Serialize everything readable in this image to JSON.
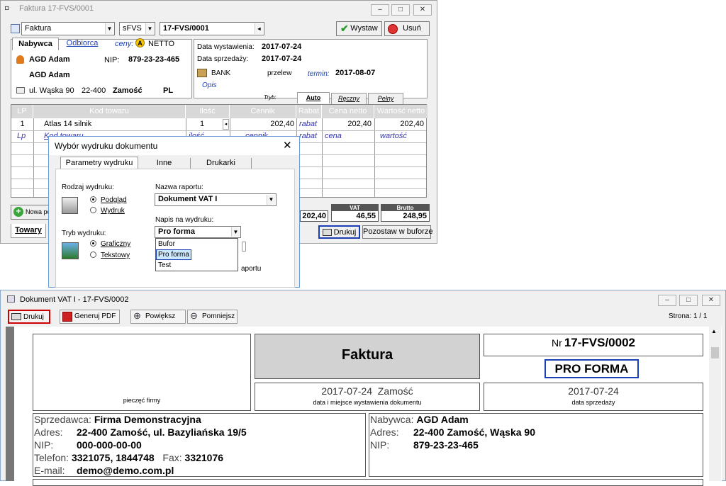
{
  "invoice_window": {
    "title": "Faktura 17-FVS/0001",
    "doc_type": "Faktura",
    "series": "sFVS",
    "number": "17-FVS/0001",
    "issue_button": "Wystaw",
    "delete_button": "Usuń",
    "tabs": [
      "Nabywca",
      "Odbiorca"
    ],
    "prices_label": "ceny:",
    "prices_mode_icon": "A",
    "prices_mode": "NETTO",
    "buyer": {
      "name": "AGD Adam",
      "nip_label": "NIP:",
      "nip": "879-23-23-465",
      "name2": "AGD Adam",
      "street": "ul. Wąska 90",
      "postal": "22-400",
      "city": "Zamość",
      "country": "PL"
    },
    "date_issue_label": "Data wystawienia:",
    "date_issue": "2017-07-24",
    "date_sale_label": "Data sprzedaży:",
    "date_sale": "2017-07-24",
    "payment_method": "BANK",
    "payment_type": "przelew",
    "due_label": "termin:",
    "due_date": "2017-08-07",
    "notes_label": "Opis",
    "mode_label": "Tryb:",
    "mode_tabs": [
      "Auto",
      "Ręczny",
      "Pełny"
    ],
    "grid_headers": [
      "LP",
      "Kod towaru",
      "Ilość",
      "Cennik",
      "Rabat",
      "Cena netto",
      "Wartość netto"
    ],
    "grid_rows": [
      [
        "1",
        "Atlas 14 silnik",
        "1",
        "202,40",
        "rabat",
        "202,40",
        "202,40"
      ]
    ],
    "grid_new_row": [
      "Lp",
      "Kod towaru",
      "ilość",
      "cennik",
      "rabat",
      "cena",
      "wartość"
    ],
    "new_button": "Nowa po",
    "net_total": "202,40",
    "vat_label": "VAT",
    "vat_total": "46,55",
    "gross_label": "Brutto",
    "gross_total": "248,95",
    "goods_tab": "Towary",
    "print_button": "Drukuj",
    "leave_buffer_button": "Pozostaw w buforze"
  },
  "print_dialog": {
    "title": "Wybór wydruku dokumentu",
    "tabs": [
      "Parametry wydruku",
      "Inne",
      "Drukarki"
    ],
    "output_label": "Rodzaj wydruku:",
    "output_options": [
      "Podgląd",
      "Wydruk"
    ],
    "report_label": "Nazwa raportu:",
    "report_value": "Dokument VAT I",
    "caption_label": "Napis na wydruku:",
    "caption_value": "Pro forma",
    "caption_options": [
      "Bufor",
      "Pro forma",
      "Test"
    ],
    "mode_label": "Tryb wydruku:",
    "mode_options": [
      "Graficzny",
      "Tekstowy"
    ],
    "partial_text": "aportu"
  },
  "preview_window": {
    "title": "Dokument VAT I - 17-FVS/0002",
    "toolbar": [
      "Drukuj",
      "Generuj PDF",
      "Powiększ",
      "Pomniejsz"
    ],
    "page_info": "Strona: 1 / 1",
    "doc": {
      "stamp_label": "pieczęć firmy",
      "doc_title": "Faktura",
      "nr_label": "Nr",
      "nr_value": "17-FVS/0002",
      "pro_forma": "PRO FORMA",
      "issue_place": "2017-07-24  Zamość",
      "issue_caption": "data i miejsce wystawienia dokumentu",
      "sale_date": "2017-07-24",
      "sale_caption": "data sprzedaży",
      "seller_label": "Sprzedawca:",
      "seller_name": "Firma Demonstracyjna",
      "seller_addr_label": "Adres:",
      "seller_addr": "22-400 Zamość, ul. Bazyliańska 19/5",
      "seller_nip_label": "NIP:",
      "seller_nip": "000-000-00-00",
      "phone_label": "Telefon:",
      "phone": "3321075, 1844748",
      "fax_label": "Fax:",
      "fax": "3321076",
      "email_label": "E-mail:",
      "email": "demo@demo.com.pl",
      "buyer_label": "Nabywca:",
      "buyer_name": "AGD Adam",
      "buyer_addr_label": "Adres:",
      "buyer_addr": "22-400 Zamość, Wąska 90",
      "buyer_nip_label": "NIP:",
      "buyer_nip": "879-23-23-465"
    }
  },
  "colors": {
    "accent_blue": "#1a3fb5",
    "highlight": "#cce8ff",
    "red_frame": "#cc0000",
    "vat_box": "#555555"
  }
}
